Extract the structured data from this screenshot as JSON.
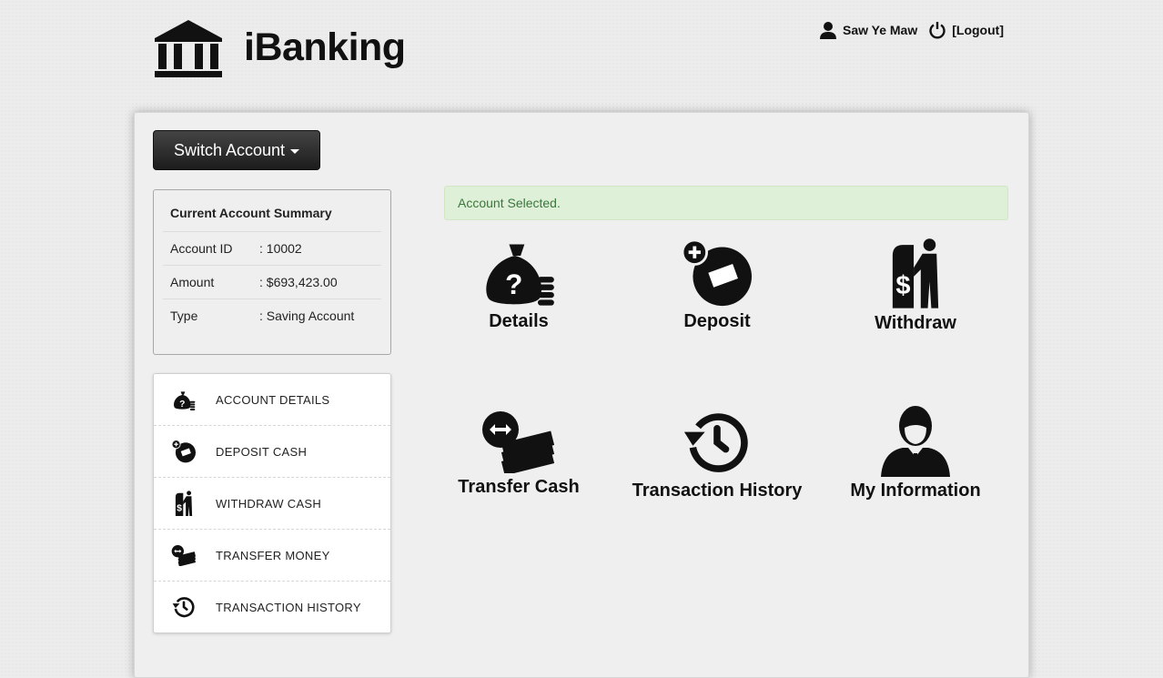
{
  "header": {
    "brand": "iBanking",
    "user_name": "Saw Ye Maw",
    "logout_label": "[Logout]"
  },
  "toolbar": {
    "switch_account_label": "Switch Account"
  },
  "summary": {
    "title": "Current Account Summary",
    "rows": [
      {
        "label": "Account ID",
        "value": ": 10002"
      },
      {
        "label": "Amount",
        "value": ": $693,423.00"
      },
      {
        "label": "Type",
        "value": ": Saving Account"
      }
    ]
  },
  "menu": {
    "items": [
      {
        "label": "ACCOUNT DETAILS",
        "icon": "money-bag-icon"
      },
      {
        "label": "DEPOSIT CASH",
        "icon": "deposit-icon"
      },
      {
        "label": "WITHDRAW CASH",
        "icon": "atm-withdraw-icon"
      },
      {
        "label": "TRANSFER MONEY",
        "icon": "transfer-icon"
      },
      {
        "label": "TRANSACTION HISTORY",
        "icon": "history-icon"
      }
    ]
  },
  "alert": {
    "text": "Account Selected."
  },
  "tiles": [
    {
      "label": "Details",
      "icon": "money-bag-icon"
    },
    {
      "label": "Deposit",
      "icon": "deposit-icon"
    },
    {
      "label": "Withdraw",
      "icon": "atm-withdraw-icon"
    },
    {
      "label": "Transfer Cash",
      "icon": "transfer-icon"
    },
    {
      "label": "Transaction History",
      "icon": "history-icon"
    },
    {
      "label": "My Information",
      "icon": "person-icon"
    }
  ],
  "colors": {
    "accent_dark": "#222222",
    "alert_bg": "#dff0d8",
    "alert_text": "#3c763d"
  }
}
